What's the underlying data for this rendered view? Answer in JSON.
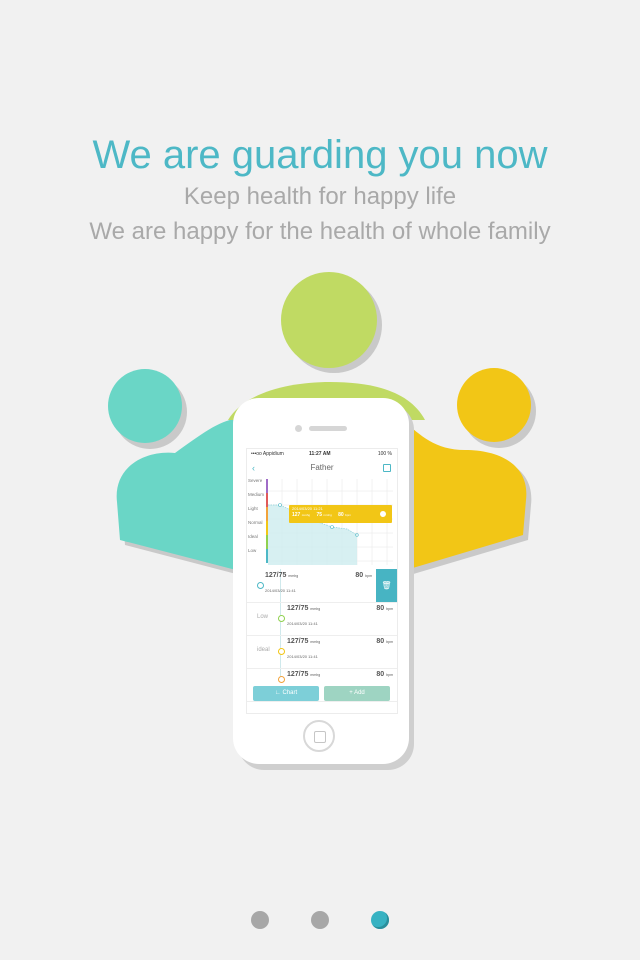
{
  "headline": "We are guarding you now",
  "subtitle_1": "Keep health for happy life",
  "subtitle_2": "We are happy for the health of whole family",
  "colors": {
    "accent": "#4db8c6",
    "figure_teal": "#6ad6c6",
    "figure_green": "#c0da63",
    "figure_yellow": "#f2c616",
    "dot_inactive": "#a7a7a7",
    "dot_active": "#37b2c2"
  },
  "phone": {
    "status": {
      "carrier": "•••oo Appidium",
      "time": "11:27 AM",
      "battery": "100 %"
    },
    "nav": {
      "title": "Father"
    },
    "chart": {
      "levels": [
        "Severe",
        "Medium",
        "Light",
        "Normal",
        "Ideal",
        "Low"
      ],
      "tooltip": {
        "date": "2014/03/20 11:21",
        "systolic": "127",
        "diastolic": "75",
        "unit": "mmhg",
        "pulse": "80",
        "pulse_unit": "bpm"
      }
    },
    "list": [
      {
        "tag": "",
        "value": "127/75",
        "unit": "mmhg",
        "bpm": "80",
        "bpm_unit": "bpm",
        "date": "2014/03/20 11:41"
      },
      {
        "tag": "Low",
        "value": "127/75",
        "unit": "mmhg",
        "bpm": "80",
        "bpm_unit": "bpm",
        "date": "2014/03/20 11:41"
      },
      {
        "tag": "ideal",
        "value": "127/75",
        "unit": "mmhg",
        "bpm": "80",
        "bpm_unit": "bpm",
        "date": "2014/03/20 11:41"
      },
      {
        "tag": "",
        "value": "127/75",
        "unit": "mmhg",
        "bpm": "80",
        "bpm_unit": "bpm",
        "date": ""
      }
    ],
    "buttons": {
      "chart": "Chart",
      "add": "Add"
    }
  },
  "pager": {
    "count": 3,
    "active_index": 2
  }
}
